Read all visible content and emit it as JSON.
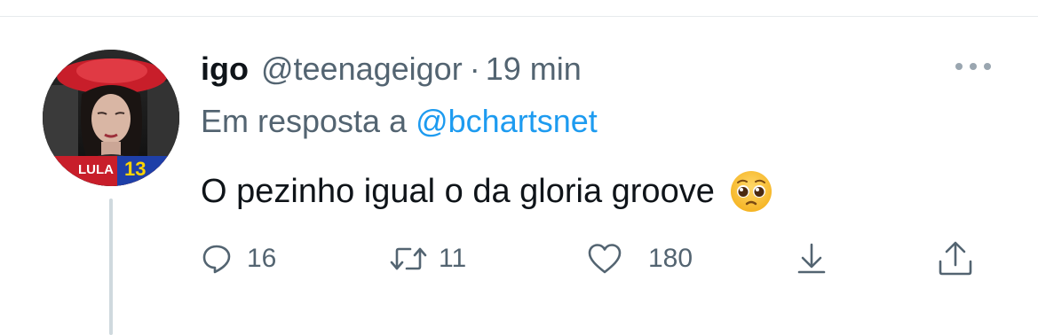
{
  "tweet": {
    "display_name": "igo",
    "handle": "@teenageigor",
    "separator": "·",
    "time": "19 min",
    "reply_prefix": "Em resposta a",
    "reply_to": "@bchartsnet",
    "text": "O pezinho igual o da gloria groove",
    "emoji_icon": "pleading-face-emoji",
    "avatar_badge_text": "LULA",
    "avatar_badge_number": "13"
  },
  "actions": {
    "reply_count": "16",
    "retweet_count": "11",
    "like_count": "180"
  },
  "colors": {
    "text_primary": "#0f1419",
    "text_secondary": "#536471",
    "link": "#1d9bf0",
    "thread_line": "#cfd9de"
  }
}
